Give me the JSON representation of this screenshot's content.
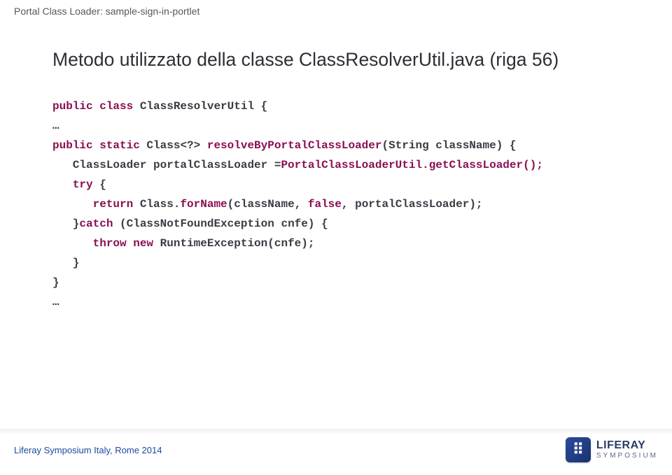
{
  "header": {
    "label": "Portal Class Loader: sample-sign-in-portlet"
  },
  "title": "Metodo utilizzato della classe ClassResolverUtil.java (riga 56)",
  "code": {
    "l1": {
      "a": "public class",
      "b": " ClassResolverUtil {"
    },
    "l2": "…",
    "l3": {
      "a": "public static",
      "b": " Class<?> ",
      "c": "resolveByPortalClassLoader",
      "d": "(String className) {"
    },
    "l4": {
      "a": "   ClassLoader portalClassLoader =",
      "b": "PortalClassLoaderUtil.getClassLoader();"
    },
    "l5": {
      "a": "   ",
      "b": "try",
      "c": " {"
    },
    "l6": {
      "a": "      ",
      "b": "return",
      "c": " Class.",
      "d": "forName",
      "e": "(className, ",
      "f": "false",
      "g": ", portalClassLoader);"
    },
    "l7": {
      "a": "   }",
      "b": "catch",
      "c": " (ClassNotFoundException cnfe) {"
    },
    "l8": {
      "a": "      ",
      "b": "throw new",
      "c": " RuntimeException(cnfe);"
    },
    "l9": "   }",
    "l10": "}",
    "l11": "…"
  },
  "footer": {
    "text": "Liferay Symposium Italy, Rome 2014"
  },
  "logo": {
    "brand": "LIFERAY",
    "sub": "SYMPOSIUM",
    "mark": "⠿"
  }
}
